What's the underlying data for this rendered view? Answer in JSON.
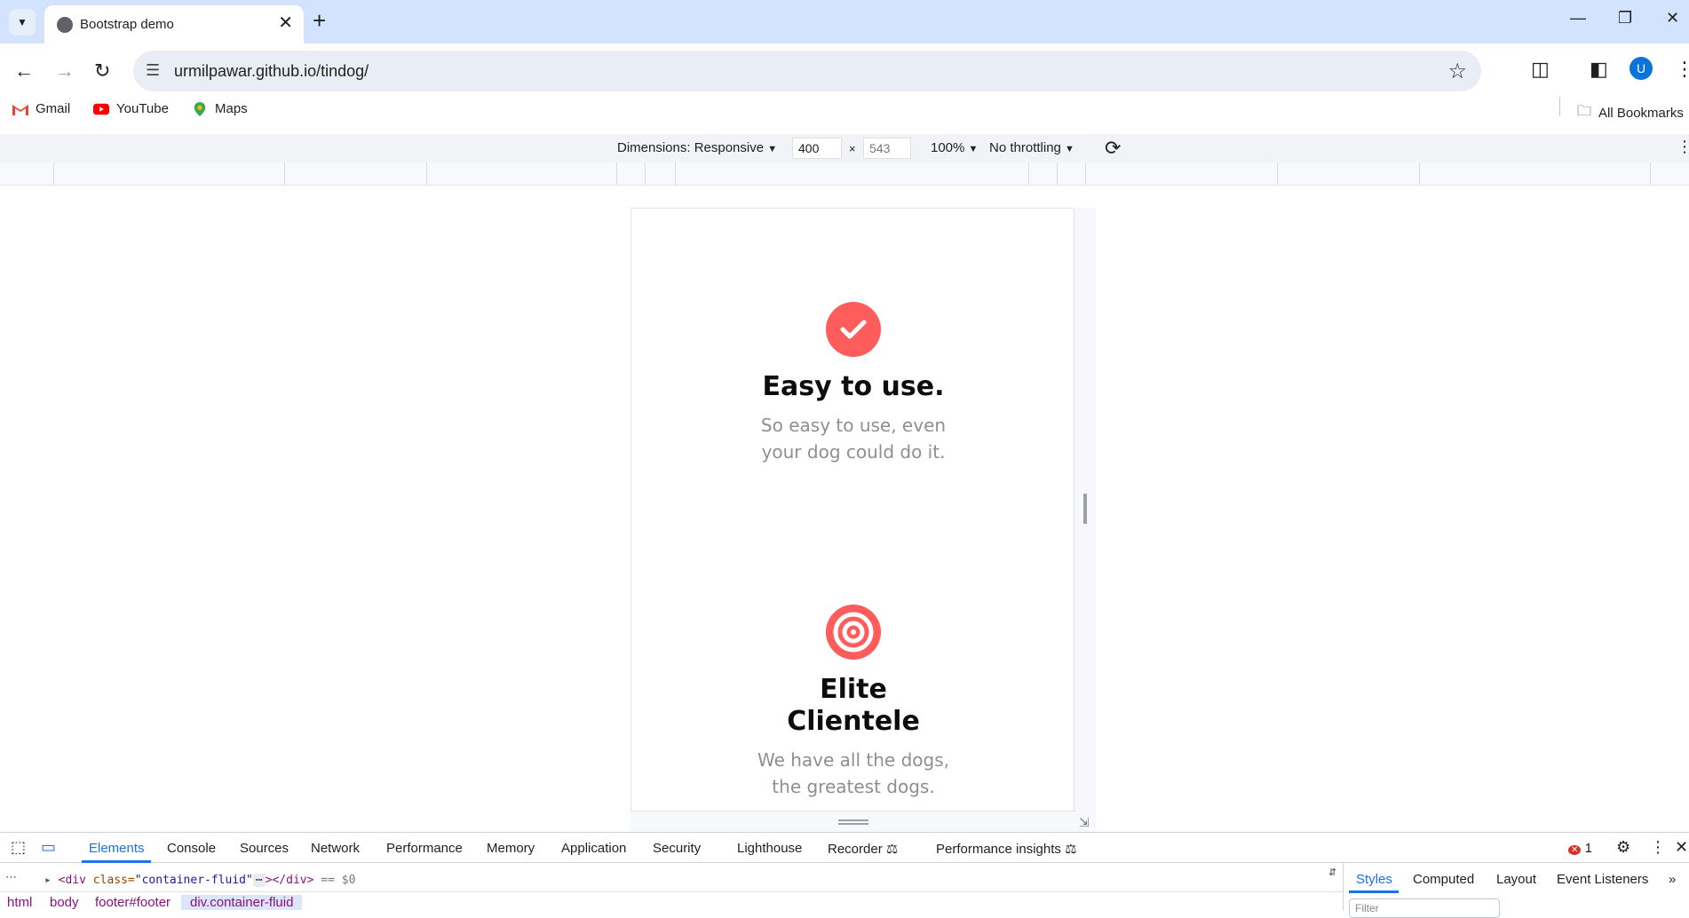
{
  "browser": {
    "tab_title": "Bootstrap demo",
    "url": "urmilpawar.github.io/tindog/",
    "profile_initial": "U"
  },
  "bookmarks": {
    "items": [
      {
        "label": "Gmail",
        "icon": "gmail-icon"
      },
      {
        "label": "YouTube",
        "icon": "youtube-icon"
      },
      {
        "label": "Maps",
        "icon": "maps-icon"
      }
    ],
    "all_bookmarks": "All Bookmarks"
  },
  "device_toolbar": {
    "dimensions_label": "Dimensions: Responsive",
    "width": "400",
    "height": "543",
    "times": "×",
    "zoom": "100%",
    "throttling": "No throttling"
  },
  "page": {
    "features": [
      {
        "icon": "check-circle-icon",
        "title": "Easy to use.",
        "text_line1": "So easy to use, even",
        "text_line2": "your dog could do it."
      },
      {
        "icon": "bullseye-icon",
        "title_line1": "Elite",
        "title_line2": "Clientele",
        "text_line1": "We have all the dogs,",
        "text_line2": "the greatest dogs."
      }
    ],
    "accent_color": "#ff5c5c"
  },
  "devtools": {
    "tabs": [
      "Elements",
      "Console",
      "Sources",
      "Network",
      "Performance",
      "Memory",
      "Application",
      "Security",
      "Lighthouse",
      "Recorder",
      "Performance insights"
    ],
    "active_tab": "Elements",
    "error_count": "1",
    "dom_line": {
      "tag_open": "<div ",
      "attr": "class=",
      "value": "\"container-fluid\"",
      "tag_close": "></div>",
      "suffix": "== $0"
    },
    "breadcrumbs": [
      "html",
      "body",
      "footer#footer",
      "div.container-fluid"
    ],
    "side_tabs": [
      "Styles",
      "Computed",
      "Layout",
      "Event Listeners"
    ],
    "filter_placeholder": "Filter"
  }
}
